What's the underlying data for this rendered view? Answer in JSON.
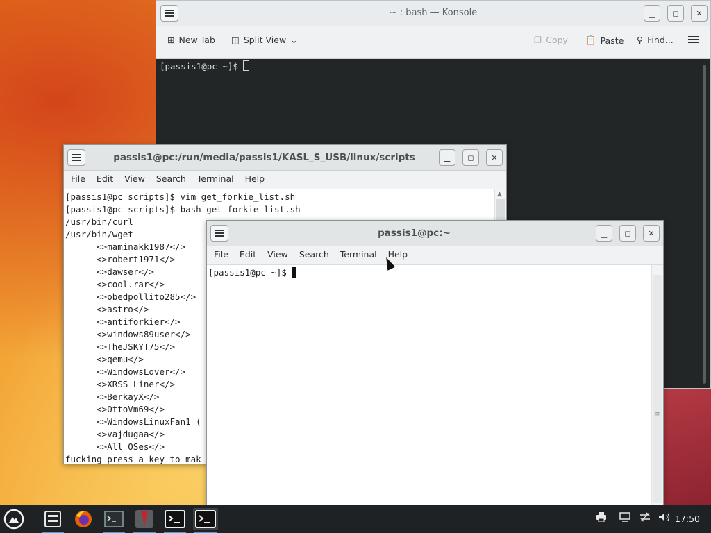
{
  "konsole": {
    "title": "~ : bash — Konsole",
    "toolbar": {
      "new_tab": "New Tab",
      "split_view": "Split View",
      "copy": "Copy",
      "paste": "Paste",
      "find": "Find..."
    },
    "terminal_lines": [
      "[passis1@pc ~]$ "
    ]
  },
  "scripts_window": {
    "title": "passis1@pc:/run/media/passis1/KASL_S_USB/linux/scripts",
    "menu": [
      "File",
      "Edit",
      "View",
      "Search",
      "Terminal",
      "Help"
    ],
    "lines": [
      "[passis1@pc scripts]$ vim get_forkie_list.sh",
      "[passis1@pc scripts]$ bash get_forkie_list.sh",
      "/usr/bin/curl",
      "/usr/bin/wget",
      "      <>maminakk1987</>",
      "      <>robert1971</>",
      "      <>dawser</>",
      "      <>cool.rar</>",
      "      <>obedpollito285</>",
      "      <>astro</>",
      "      <>antiforkier</>",
      "      <>windows89user</>",
      "      <>TheJSKYT75</>",
      "      <>qemu</>",
      "      <>WindowsLover</>",
      "      <>XRSS Liner</>",
      "      <>BerkayX</>",
      "      <>OttoVm69</>",
      "      <>WindowsLinuxFan1 (",
      "      <>vajdugaa</>",
      "      <>All OSes</>",
      "fucking press a key to mak"
    ]
  },
  "home_window": {
    "title": "passis1@pc:~",
    "menu": [
      "File",
      "Edit",
      "View",
      "Search",
      "Terminal",
      "Help"
    ],
    "prompt": "[passis1@pc ~]$ "
  },
  "taskbar": {
    "clock": "17:50",
    "items": [
      "app-launcher",
      "file-manager",
      "firefox",
      "terminal",
      "vivaldi-browser",
      "terminal-active",
      "terminal-selected"
    ]
  }
}
